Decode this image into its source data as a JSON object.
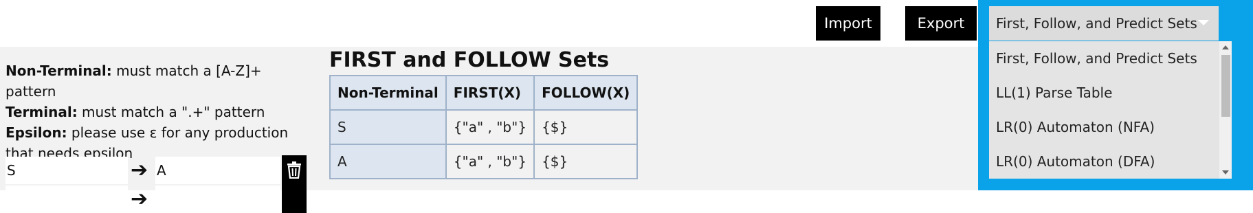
{
  "toolbar": {
    "import_label": "Import",
    "export_label": "Export"
  },
  "legend": {
    "nonterminal_term": "Non-Terminal:",
    "nonterminal_desc": " must match a [A-Z]+ pattern",
    "terminal_term": "Terminal:",
    "terminal_desc": " must match a \".+\" pattern",
    "epsilon_term": "Epsilon:",
    "epsilon_desc": " please use ε for any production that needs epsilon"
  },
  "productions": [
    {
      "lhs": "S",
      "arrow": "➔",
      "rhs": "A"
    },
    {
      "lhs": "",
      "arrow": "➔",
      "rhs": ""
    }
  ],
  "sets": {
    "title": "FIRST and FOLLOW Sets",
    "headers": [
      "Non-Terminal",
      "FIRST(X)",
      "FOLLOW(X)"
    ],
    "rows": [
      [
        "S",
        "{\"a\" , \"b\"}",
        "{$}"
      ],
      [
        "A",
        "{\"a\" , \"b\"}",
        "{$}"
      ]
    ]
  },
  "view_select": {
    "selected": "First, Follow, and Predict Sets",
    "options": [
      "First, Follow, and Predict Sets",
      "LL(1) Parse Table",
      "LR(0) Automaton (NFA)",
      "LR(0) Automaton (DFA)"
    ],
    "highlight_color": "#0aa2e8"
  }
}
